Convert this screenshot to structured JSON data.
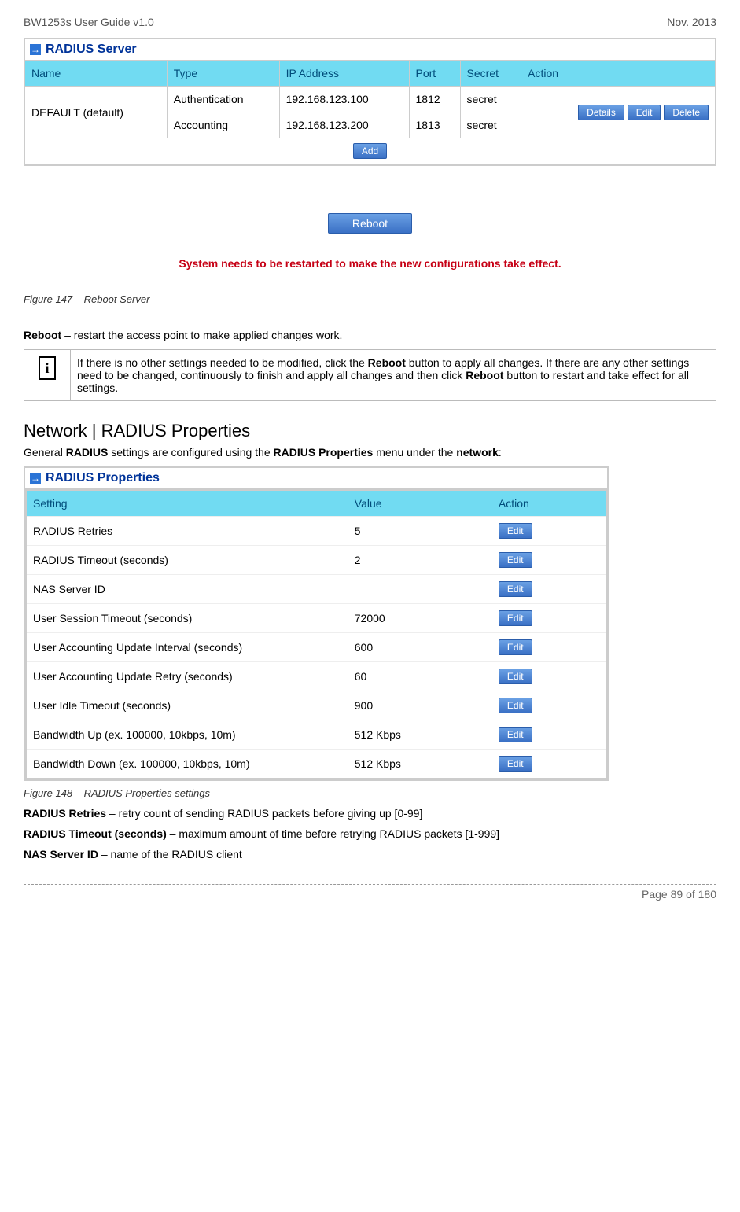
{
  "header_left": "BW1253s User Guide v1.0",
  "header_right": "Nov.  2013",
  "radius_server": {
    "title": "RADIUS Server",
    "cols": [
      "Name",
      "Type",
      "IP Address",
      "Port",
      "Secret",
      "Action"
    ],
    "name_cell": "DEFAULT (default)",
    "rows": [
      {
        "type": "Authentication",
        "ip": "192.168.123.100",
        "port": "1812",
        "secret": "secret"
      },
      {
        "type": "Accounting",
        "ip": "192.168.123.200",
        "port": "1813",
        "secret": "secret"
      }
    ],
    "actions": {
      "details": "Details",
      "edit": "Edit",
      "delete": "Delete"
    },
    "add_label": "Add"
  },
  "reboot_btn": "Reboot",
  "reboot_msg": "System needs to be restarted to make the new configurations take effect.",
  "fig147": "Figure 147 – Reboot Server",
  "reboot_text_pre": "Reboot",
  "reboot_text_rest": " – restart the access point to make applied changes work.",
  "note_text_1": "If there is no other settings needed to be modified, click the ",
  "note_bold_1": "Reboot",
  "note_text_2": " button to apply all changes. If there are any other settings need to be changed, continuously to finish and apply all changes and then click ",
  "note_bold_2": "Reboot",
  "note_text_3": " button to restart and take effect  for all settings.",
  "section_title": "Network | RADIUS Properties",
  "general_pre": "General ",
  "general_bold1": "RADIUS",
  "general_mid": " settings are configured using the ",
  "general_bold2": "RADIUS Properties",
  "general_mid2": " menu under the ",
  "general_bold3": "network",
  "general_end": ":",
  "radius_props": {
    "title": "RADIUS Properties",
    "cols": [
      "Setting",
      "Value",
      "Action"
    ],
    "edit_label": "Edit",
    "rows": [
      {
        "setting": "RADIUS Retries",
        "value": "5"
      },
      {
        "setting": "RADIUS Timeout (seconds)",
        "value": "2"
      },
      {
        "setting": "NAS Server ID",
        "value": ""
      },
      {
        "setting": "User Session Timeout (seconds)",
        "value": "72000"
      },
      {
        "setting": "User Accounting Update Interval (seconds)",
        "value": "600"
      },
      {
        "setting": "User Accounting Update Retry (seconds)",
        "value": "60"
      },
      {
        "setting": "User Idle Timeout (seconds)",
        "value": "900"
      },
      {
        "setting": "Bandwidth Up (ex. 100000, 10kbps, 10m)",
        "value": "512 Kbps"
      },
      {
        "setting": "Bandwidth Down (ex. 100000, 10kbps, 10m)",
        "value": "512 Kbps"
      }
    ]
  },
  "fig148": "Figure 148 – RADIUS Properties settings",
  "desc1_bold": "RADIUS Retries",
  "desc1_rest": " – retry count of sending RADIUS packets before giving up [0-99]",
  "desc2_bold": "RADIUS Timeout (seconds)",
  "desc2_rest": " – maximum amount of time before retrying RADIUS packets [1-999]",
  "desc3_bold": "NAS Server ID",
  "desc3_rest": " – name of the RADIUS client",
  "footer": "Page 89 of 180"
}
